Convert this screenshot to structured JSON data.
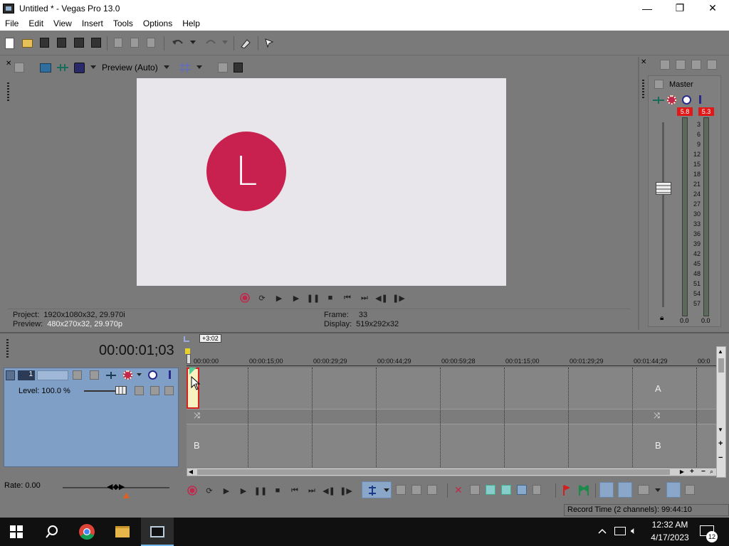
{
  "window": {
    "title": "Untitled * - Vegas Pro 13.0",
    "minimize": "—",
    "maximize": "❐",
    "close": "✕"
  },
  "menu": [
    "File",
    "Edit",
    "View",
    "Insert",
    "Tools",
    "Options",
    "Help"
  ],
  "preview": {
    "quality_label": "Preview (Auto)",
    "avatar_letter": "L",
    "project_label": "Project:",
    "project_value": "1920x1080x32, 29.970i",
    "preview_label": "Preview:",
    "preview_value": "480x270x32, 29.970p",
    "frame_label": "Frame:",
    "frame_value": "33",
    "display_label": "Display:",
    "display_value": "519x292x32"
  },
  "mixer": {
    "master_label": "Master",
    "peak_left": "5.8",
    "peak_right": "5.3",
    "scale": [
      "3",
      "6",
      "9",
      "12",
      "15",
      "18",
      "21",
      "24",
      "27",
      "30",
      "33",
      "36",
      "39",
      "42",
      "45",
      "48",
      "51",
      "54",
      "57"
    ],
    "bottom_left": "0.0",
    "bottom_right": "0.0"
  },
  "timeline": {
    "timecode": "00:00:01;03",
    "offset_badge": "+3:02",
    "ruler": [
      "00:00:00",
      "00:00:15;00",
      "00:00:29;29",
      "00:00:44;29",
      "00:00:59;28",
      "00:01:15;00",
      "00:01:29;29",
      "00:01:44;29",
      "00:0"
    ],
    "track_number": "1",
    "level_label": "Level: 100.0 %",
    "lane_a": "A",
    "lane_b": "B"
  },
  "status": {
    "rate_label": "Rate: 0.00",
    "record_time": "Record Time (2 channels): 99:44:10"
  },
  "taskbar": {
    "time": "12:32 AM",
    "date": "4/17/2023",
    "notifications": "12"
  }
}
